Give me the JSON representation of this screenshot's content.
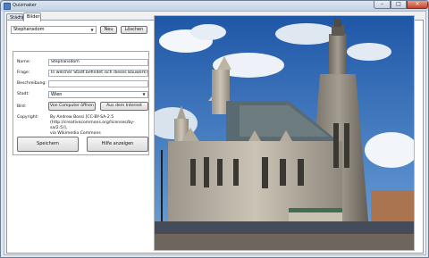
{
  "window": {
    "title": "Quizmaker"
  },
  "tabs": [
    {
      "label": "Städte",
      "active": false
    },
    {
      "label": "Bilder",
      "active": true
    }
  ],
  "toolbar": {
    "picture_select": "Stephansdom",
    "new_label": "Neu",
    "delete_label": "Löschen"
  },
  "form": {
    "name_label": "Name:",
    "name_value": "Stephansdom",
    "question_label": "Frage:",
    "question_value": "In welcher Stadt befindet sich dieses Bauwerk?",
    "description_label": "Beschreibung:",
    "description_value": "",
    "city_label": "Stadt:",
    "city_value": "Wien",
    "image_label": "Bild:",
    "from_computer_label": "Von Computer öffnen",
    "from_internet_label": "Aus dem Internet",
    "copyright_label": "Copyright:",
    "copyright_line1": "By Andrew Bossi [CC-BY-SA-2.5",
    "copyright_line2": "(http://creativecommons.org/licenses/by-sa/2.5)],",
    "copyright_line3": "via Wikimedia Commons",
    "save_label": "Speichern",
    "help_label": "Hilfe anzeigen"
  },
  "colors": {
    "accent": "#4c7fbf",
    "close": "#c7432a"
  }
}
